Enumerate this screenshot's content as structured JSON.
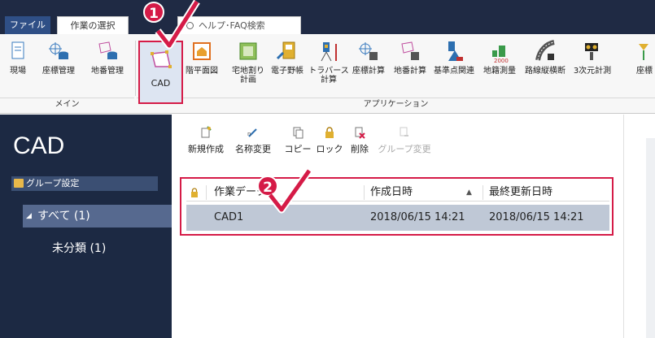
{
  "tabs": {
    "file": "ファイル",
    "work_select": "作業の選択",
    "help_search": "ヘルプ･FAQ検索"
  },
  "ribbon": {
    "main_items": [
      {
        "label": "現場",
        "icon": "site-icon"
      },
      {
        "label": "座標管理",
        "icon": "coord-db-icon"
      },
      {
        "label": "地番管理",
        "icon": "parcel-db-icon"
      }
    ],
    "cad_label": "CAD",
    "app_items": [
      {
        "label": "階平面図",
        "icon": "floor-plan-icon"
      },
      {
        "label": "宅地割り\n計画",
        "icon": "lot-plan-icon"
      },
      {
        "label": "電子野帳",
        "icon": "field-book-icon"
      },
      {
        "label": "トラバース\n計算",
        "icon": "traverse-icon"
      },
      {
        "label": "座標計算",
        "icon": "coord-calc-icon"
      },
      {
        "label": "地番計算",
        "icon": "parcel-calc-icon"
      },
      {
        "label": "基準点関連",
        "icon": "benchmark-icon"
      },
      {
        "label": "地籍測量",
        "icon": "cadastral-icon"
      },
      {
        "label": "路線縦横断",
        "icon": "road-profile-icon"
      },
      {
        "label": "3次元計測",
        "icon": "3d-measure-icon"
      },
      {
        "label": "座標",
        "icon": "coord-icon"
      }
    ],
    "group_main": "メイン",
    "group_app": "アプリケーション"
  },
  "badges": {
    "step1": "1",
    "step2": "2"
  },
  "sidebar": {
    "title": "CAD",
    "group_label": "グループ設定",
    "all_label": "すべて (1)",
    "unclassified_label": "未分類 (1)"
  },
  "toolbar": {
    "new": "新規作成",
    "rename": "名称変更",
    "copy": "コピー",
    "lock": "ロック",
    "delete": "削除",
    "group_change": "グループ変更"
  },
  "table": {
    "columns": {
      "name": "作業データ",
      "created": "作成日時",
      "updated": "最終更新日時"
    },
    "rows": [
      {
        "name": "CAD1",
        "created": "2018/06/15 14:21",
        "updated": "2018/06/15 14:21"
      }
    ]
  },
  "colors": {
    "accent": "#d51b47",
    "sidebar": "#1c2943",
    "selected_row": "#bfc8d6"
  }
}
